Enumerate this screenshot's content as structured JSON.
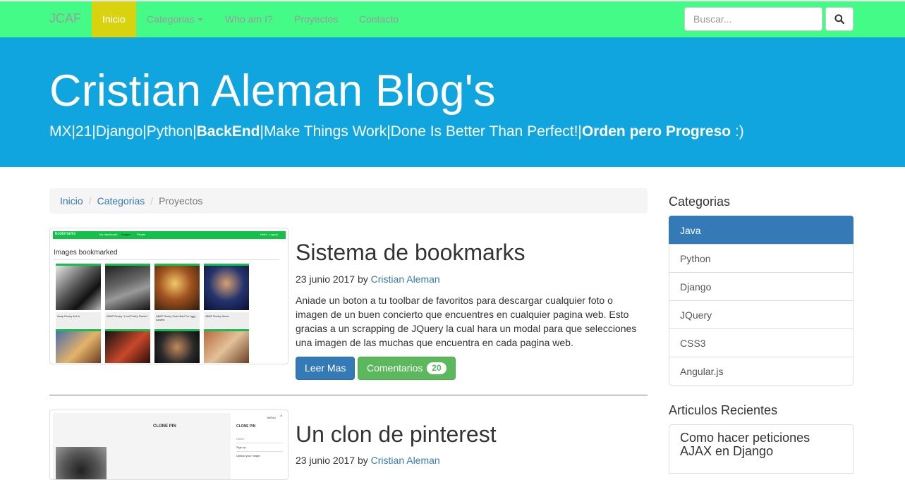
{
  "navbar": {
    "brand": "JCAF",
    "items": [
      {
        "label": "Inicio",
        "active": true
      },
      {
        "label": "Categorias",
        "dropdown": true
      },
      {
        "label": "Who am I?"
      },
      {
        "label": "Proyectos"
      },
      {
        "label": "Contacto"
      }
    ],
    "search_placeholder": "Buscar...",
    "search_icon": "search-icon"
  },
  "jumbotron": {
    "title": "Cristian Aleman Blog's",
    "subtitle_parts": [
      "MX|21|Django|Python|",
      "BackEnd",
      "|Make Things Work|Done Is Better Than Perfect!|",
      "Orden pero Progreso",
      " :)"
    ]
  },
  "breadcrumb": {
    "items": [
      "Inicio",
      "Categorias"
    ],
    "current": "Proyectos"
  },
  "posts": [
    {
      "title": "Sistema de bookmarks",
      "date": "23 junio 2017",
      "by": "by",
      "author": "Cristian Aleman",
      "body": "Aniade un boton a tu toolbar de favoritos para descargar cualquier foto o imagen de un buen concierto que encuentres en cualquier pagina web. Esto gracias a un scrapping de JQuery la cual hara un modal para que selecciones una imagen de las muchas que encuentra en cada pagina web.",
      "read_more": "Leer Mas",
      "comments_label": "Comentarios",
      "comments_count": "20",
      "thumbnail": {
        "app_name": "bookmarks",
        "nav_links": [
          "My dashboard",
          "Images",
          "People"
        ],
        "user_links": "Hello · Logout",
        "heading": "Images bookmarked",
        "captions": [
          "Asap Rocky ALLA",
          "A$AP Rocky \"Lord Pretty Flacko\"",
          "A$AP Rocky Feds Bad For Iggy Azalea",
          "A$AP Rocky News"
        ]
      }
    },
    {
      "title": "Un clon de pinterest",
      "date": "23 junio 2017",
      "by": "by",
      "author": "Cristian Aleman",
      "thumbnail": {
        "heading": "CLONE PIN",
        "menu_label": "MENU",
        "menu_title": "CLONE PIN",
        "menu_items": [
          "Home",
          "Sign up",
          "Upload your image"
        ]
      }
    }
  ],
  "sidebar": {
    "categories_title": "Categorias",
    "categories": [
      "Java",
      "Python",
      "Django",
      "JQuery",
      "CSS3",
      "Angular.js"
    ],
    "active_category": "Java",
    "recent_title": "Articulos Recientes",
    "recent": [
      "Como hacer peticiones AJAX en Django"
    ]
  },
  "colors": {
    "navbar_bg": "#44fb88",
    "nav_active_bg": "#d9d20e",
    "jumbotron_bg": "#10a5de",
    "primary": "#337ab7",
    "success": "#5cb85c"
  }
}
